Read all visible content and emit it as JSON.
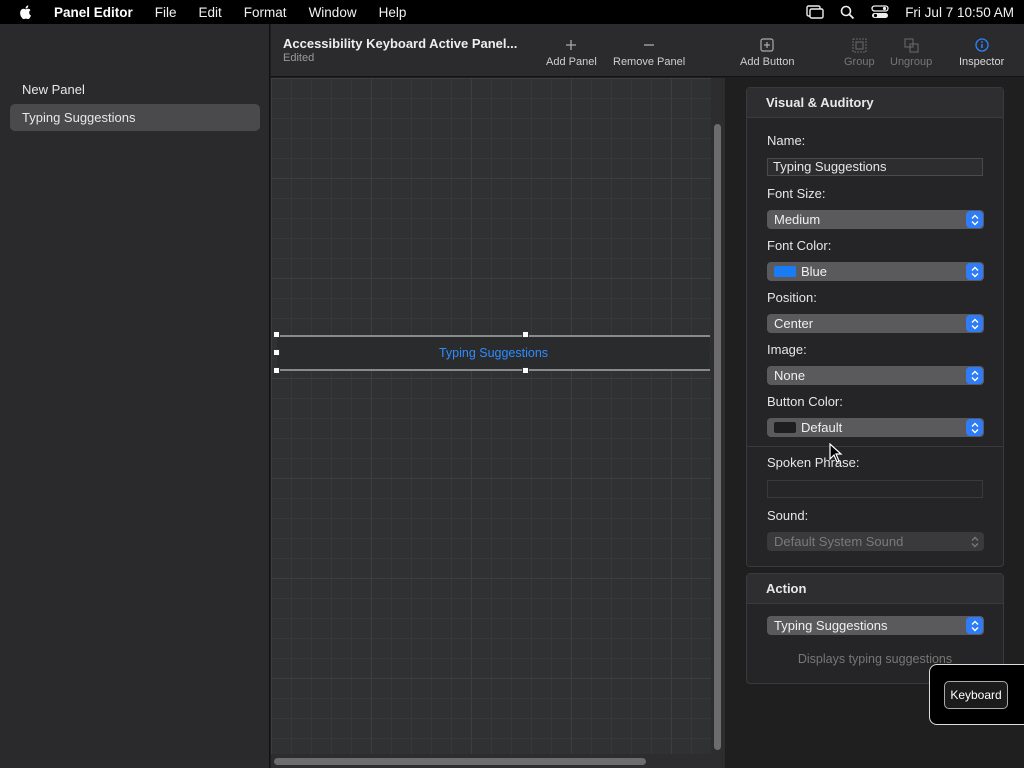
{
  "menubar": {
    "app_name": "Panel Editor",
    "items": [
      "File",
      "Edit",
      "Format",
      "Window",
      "Help"
    ],
    "clock": "Fri Jul 7  10:50 AM"
  },
  "sidebar": {
    "items": [
      {
        "label": "New Panel",
        "selected": false
      },
      {
        "label": "Typing Suggestions",
        "selected": true
      }
    ]
  },
  "toolbar": {
    "title": "Accessibility Keyboard Active Panel...",
    "subtitle": "Edited",
    "buttons": {
      "add_panel": "Add Panel",
      "remove_panel": "Remove Panel",
      "add_button": "Add Button",
      "group": "Group",
      "ungroup": "Ungroup",
      "inspector": "Inspector"
    }
  },
  "canvas": {
    "selected_button_label": "Typing Suggestions"
  },
  "inspector": {
    "visual": {
      "header": "Visual & Auditory",
      "name_label": "Name:",
      "name_value": "Typing Suggestions",
      "font_size_label": "Font Size:",
      "font_size_value": "Medium",
      "font_color_label": "Font Color:",
      "font_color_value": "Blue",
      "font_color_swatch": "#1a7cf5",
      "position_label": "Position:",
      "position_value": "Center",
      "image_label": "Image:",
      "image_value": "None",
      "button_color_label": "Button Color:",
      "button_color_value": "Default",
      "button_color_swatch": "#1e1e1e",
      "spoken_label": "Spoken Phrase:",
      "spoken_value": "",
      "sound_label": "Sound:",
      "sound_value": "Default System Sound"
    },
    "action": {
      "header": "Action",
      "value": "Typing Suggestions",
      "description": "Displays typing suggestions"
    }
  },
  "keyboard_hud": {
    "label": "Keyboard"
  },
  "colors": {
    "accent": "#2f7cf6",
    "canvas_text": "#2f8cff"
  }
}
